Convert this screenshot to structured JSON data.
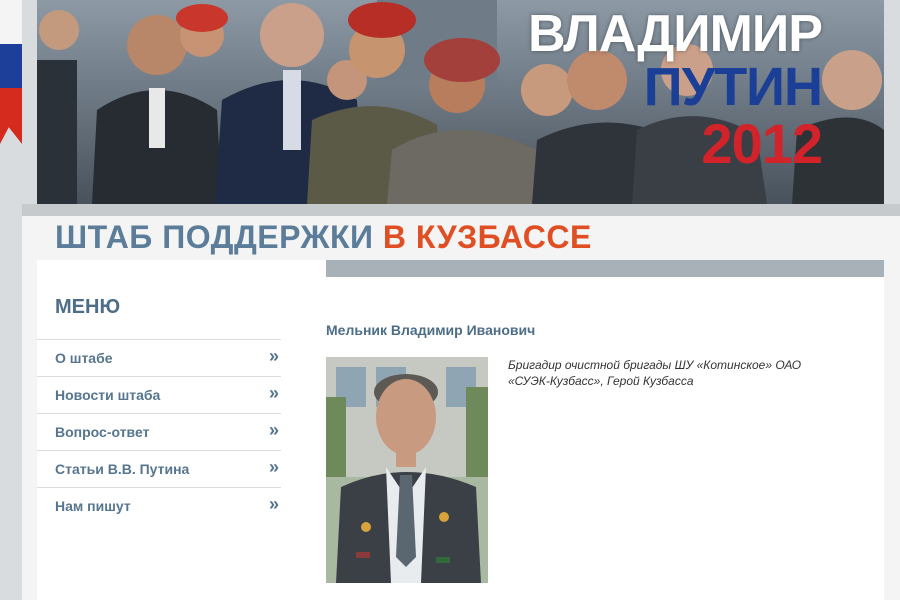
{
  "banner": {
    "line1": "ВЛАДИМИР",
    "line2": "ПУТИН",
    "line3": "2012"
  },
  "heading": {
    "part1": "ШТАБ ПОДДЕРЖКИ",
    "part2": "В КУЗБАССЕ"
  },
  "menu": {
    "title": "МЕНЮ",
    "arrow": "»",
    "items": [
      {
        "label": "О штабе"
      },
      {
        "label": "Новости штаба"
      },
      {
        "label": "Вопрос-ответ"
      },
      {
        "label": "Статьи В.В. Путина"
      },
      {
        "label": "Нам пишут"
      }
    ]
  },
  "article": {
    "name": "Мельник Владимир Иванович",
    "description": "Бригадир очистной бригады ШУ «Котинское» ОАО «СУЭК-Кузбасс», Герой Кузбасса"
  },
  "colors": {
    "accent_blue": "#5b7d99",
    "accent_orange": "#e04f23",
    "flag_blue": "#1d3f9a",
    "flag_red": "#d52b1e"
  }
}
